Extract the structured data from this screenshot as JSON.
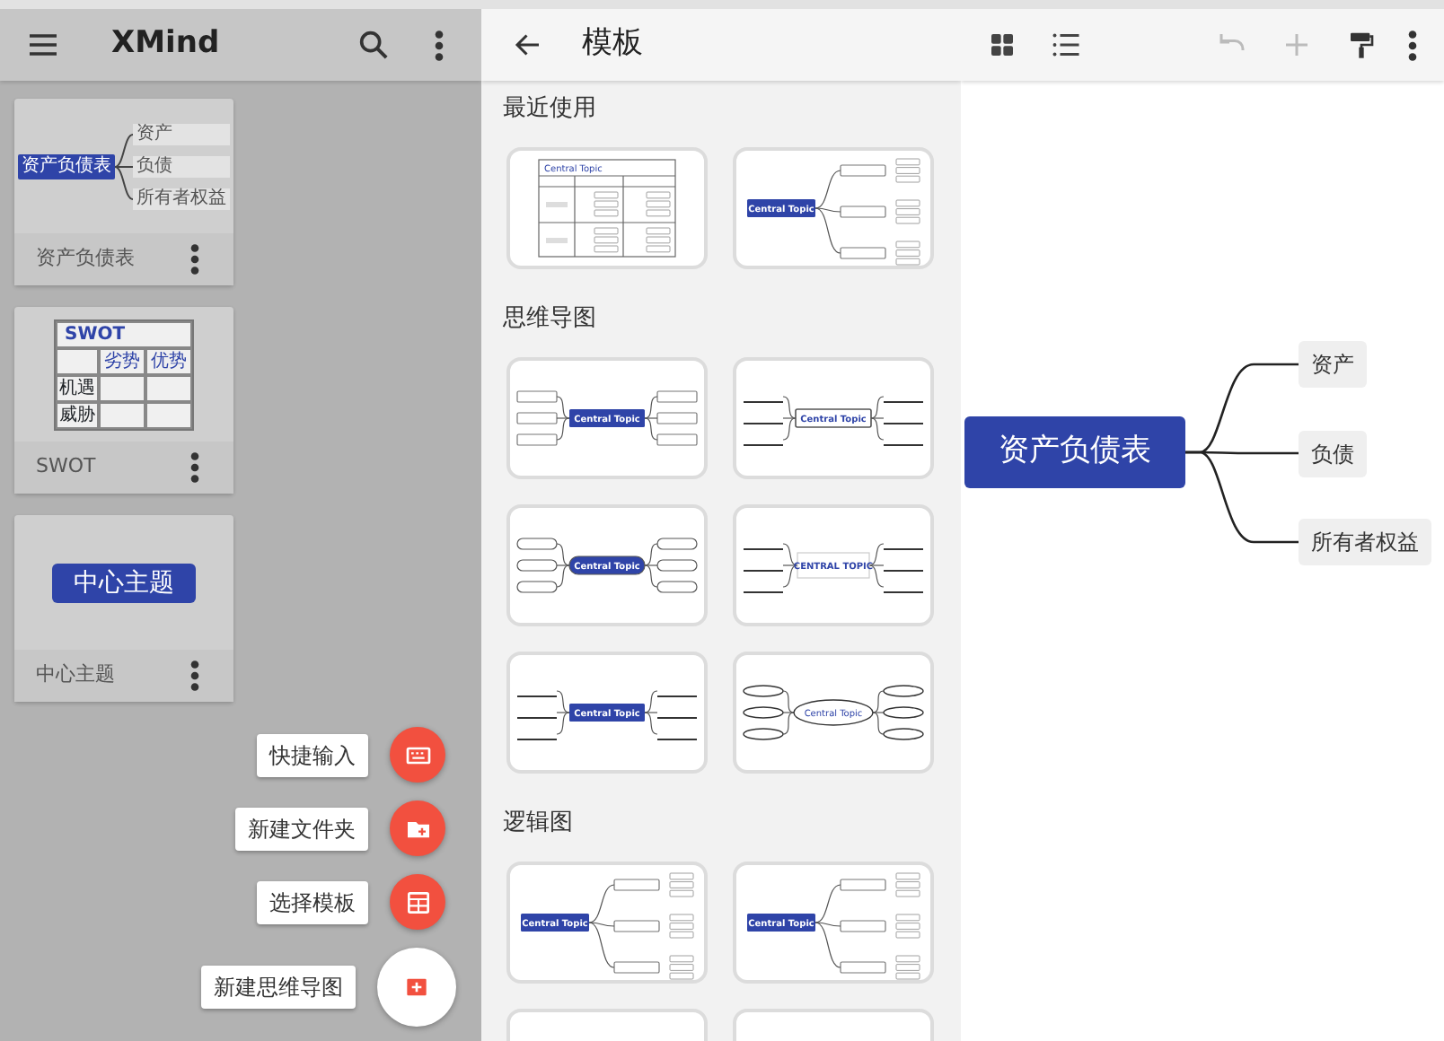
{
  "home": {
    "title": "XMind",
    "files": [
      {
        "name": "资产负债表",
        "preview": {
          "kind": "map",
          "central": "资产负债表",
          "branches": [
            "资产",
            "负债",
            "所有者权益"
          ]
        }
      },
      {
        "name": "SWOT",
        "preview": {
          "kind": "swot",
          "title": "SWOT",
          "header": [
            "劣势",
            "优势"
          ],
          "rows": [
            "机遇",
            "威胁"
          ]
        }
      },
      {
        "name": "中心主题",
        "preview": {
          "kind": "topic",
          "central": "中心主题"
        }
      }
    ],
    "actions": [
      {
        "label": "快捷输入",
        "kind": "keyboard"
      },
      {
        "label": "新建文件夹",
        "kind": "folder"
      },
      {
        "label": "选择模板",
        "kind": "template"
      },
      {
        "label": "新建思维导图",
        "kind": "new"
      }
    ]
  },
  "templates": {
    "title": "模板",
    "sections": [
      {
        "title": "最近使用",
        "items": [
          {
            "kind": "matrix",
            "central": "Central Topic"
          },
          {
            "kind": "logic",
            "central": "Central Topic"
          }
        ]
      },
      {
        "title": "思维导图",
        "items": [
          {
            "kind": "map",
            "central": "Central Topic"
          },
          {
            "kind": "outline",
            "central": "Central Topic"
          },
          {
            "kind": "pill",
            "central": "Central Topic"
          },
          {
            "kind": "caps",
            "central": "CENTRAL TOPIC"
          },
          {
            "kind": "bracket",
            "central": "Central Topic"
          },
          {
            "kind": "bubble",
            "central": "Central Topic"
          }
        ]
      },
      {
        "title": "逻辑图",
        "items": [
          {
            "kind": "logic",
            "central": "Central Topic"
          },
          {
            "kind": "logic",
            "central": "Central Topic"
          },
          {
            "kind": "blank"
          },
          {
            "kind": "blank"
          }
        ]
      }
    ]
  },
  "editor": {
    "undo_disabled": true,
    "add_disabled": true,
    "map": {
      "central": "资产负债表",
      "branches": [
        "资产",
        "负债",
        "所有者权益"
      ]
    }
  }
}
